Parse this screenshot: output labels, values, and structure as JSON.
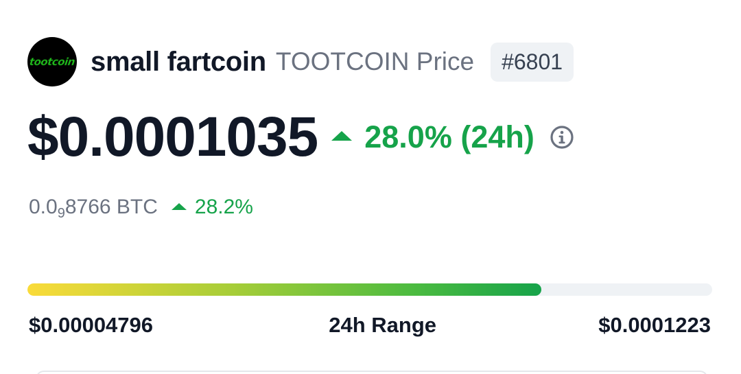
{
  "coin": {
    "logo_text": "tootcoin",
    "name": "small fartcoin",
    "symbol_label": "TOOTCOIN Price",
    "rank": "#6801"
  },
  "price": {
    "usd": "$0.0001035",
    "change_24h": "28.0% (24h)",
    "change_direction": "up"
  },
  "btc": {
    "value_prefix": "0.0",
    "value_zero_count": "9",
    "value_rest": "8766 BTC",
    "change": "28.2%"
  },
  "range": {
    "low": "$0.00004796",
    "label": "24h Range",
    "high": "$0.0001223",
    "fill_fraction": 0.75
  },
  "colors": {
    "up_green": "#16a34a",
    "text_dark": "#111827",
    "text_muted": "#6b7280",
    "badge_bg": "#eff2f5"
  },
  "icons": {
    "info": "info-circle-icon",
    "up": "caret-up-icon"
  }
}
